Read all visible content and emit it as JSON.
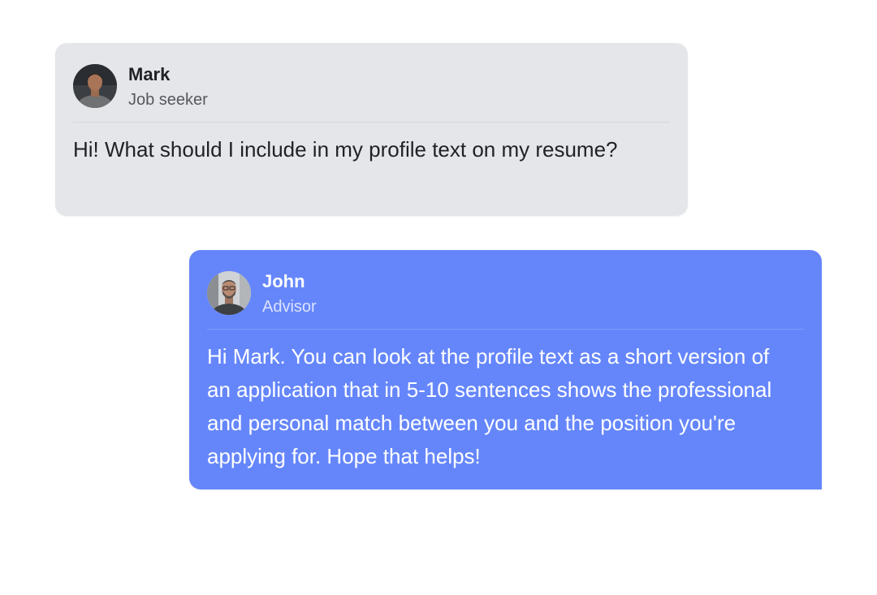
{
  "messages": [
    {
      "sender_name": "Mark",
      "sender_role": "Job seeker",
      "text": "Hi! What should I include in my profile text on my resume?"
    },
    {
      "sender_name": "John",
      "sender_role": "Advisor",
      "text": "Hi Mark. You can look at the profile text as a short version of an application that in 5-10 sentences shows the professional and personal match between you and the position you're applying for. Hope that helps!"
    }
  ],
  "colors": {
    "seeker_bubble": "#e4e6ea",
    "advisor_bubble": "#6586fb",
    "seeker_text": "#1f2124",
    "advisor_text": "#ffffff"
  },
  "icons": [
    "avatar-mark",
    "avatar-john"
  ]
}
